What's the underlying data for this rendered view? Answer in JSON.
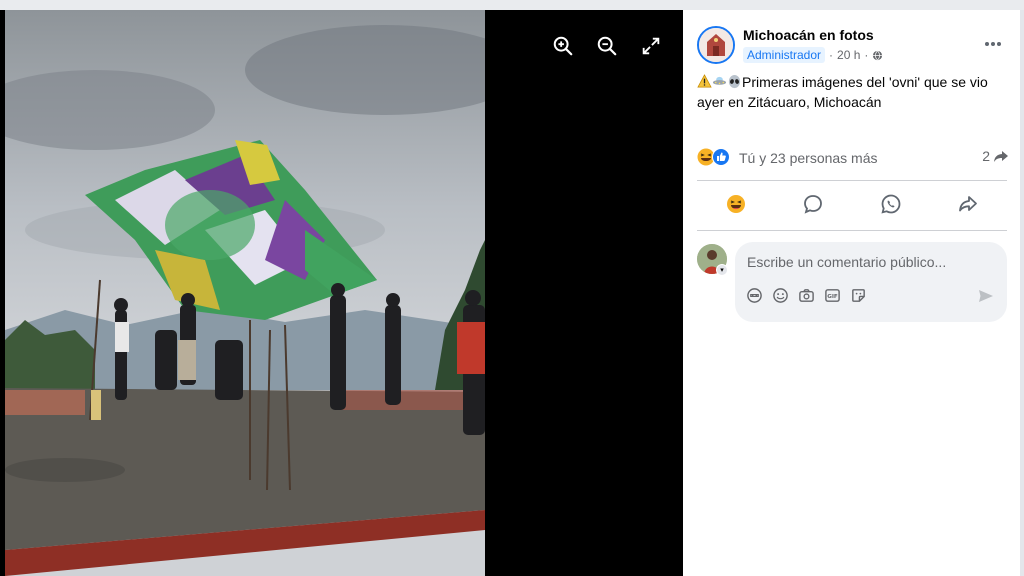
{
  "post": {
    "page_name": "Michoacán en fotos",
    "role": "Administrador",
    "time": "20 h",
    "separator": "·",
    "caption_line1": "Primeras imágenes del 'ovni' que se vio",
    "caption_line2": "ayer en Zitácuaro, Michoacán",
    "caption_emojis": [
      "warning-emoji",
      "ufo-emoji",
      "alien-emoji"
    ]
  },
  "reactions": {
    "icons": [
      "haha-reaction-icon",
      "like-reaction-icon"
    ],
    "summary": "Tú y 23 personas más",
    "share_count": "2"
  },
  "actions": [
    {
      "name": "react-button",
      "icon": "laughing-face-icon"
    },
    {
      "name": "comment-button",
      "icon": "speech-bubble-icon"
    },
    {
      "name": "whatsapp-button",
      "icon": "whatsapp-icon"
    },
    {
      "name": "share-button",
      "icon": "share-arrow-icon"
    }
  ],
  "comment": {
    "placeholder": "Escribe un comentario público...",
    "tools": [
      "avatar-sticker-icon",
      "emoji-icon",
      "camera-icon",
      "gif-icon",
      "sticker-icon"
    ],
    "send_icon": "send-icon"
  },
  "viewer": {
    "tools": [
      "zoom-in-icon",
      "zoom-out-icon",
      "fullscreen-icon"
    ],
    "photo": "people launching a giant tissue-paper hot-air balloon on a rooftop"
  },
  "colors": {
    "accent": "#1877f2",
    "badge_bg": "#e7f3ff",
    "secondary_text": "#65676b",
    "viewer_bg": "#000000"
  }
}
